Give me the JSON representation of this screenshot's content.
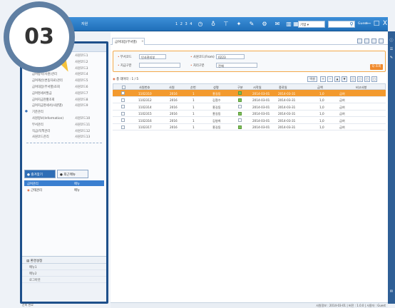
{
  "badge": {
    "number": "03"
  },
  "colors": {
    "accent": "#1f6fb9",
    "highlight": "#f39a2e",
    "sidebar_border": "#1d4f8a"
  },
  "topbar": {
    "app_title": "자원",
    "nums": "1 2 3 4",
    "tool_icons": [
      "clock-icon",
      "bulb-icon",
      "hanger-icon",
      "pin-icon",
      "edit-icon",
      "gear-icon",
      "mail-icon",
      "chart-icon",
      "calendar-icon"
    ],
    "menu_select": "기업 ▾",
    "user_name": "Guest",
    "window_buttons": [
      "—",
      "□",
      "X"
    ]
  },
  "sidebar": {
    "top_rows": [
      {
        "label": "",
        "value": "사원코드1"
      },
      {
        "label": "",
        "value": "사원코드2"
      },
      {
        "label": "",
        "value": "사원코드3"
      },
      {
        "label": "급여항목(사원)관리",
        "value": "사원코드4"
      },
      {
        "label": "급여계산(변동자료)관리",
        "value": "사원코드5"
      },
      {
        "label": "급여대장(부서별)조회",
        "value": "사원코드6"
      },
      {
        "label": "급여명세서발급",
        "value": "사원코드7"
      },
      {
        "label": "급여지급현황조회",
        "value": "사원코드8"
      },
      {
        "label": "급여지급명세서(사원별)",
        "value": "사원코드9"
      }
    ],
    "group_rows": [
      {
        "label": "기준관리",
        "value": ""
      },
      {
        "label": "사원정보(Information)",
        "value": "사원코드10"
      },
      {
        "label": "부서관리",
        "value": "사원코드11"
      },
      {
        "label": "직급/직책관리",
        "value": "사원코드12"
      },
      {
        "label": "사원코드관리",
        "value": "사원코드13"
      }
    ],
    "tabs": [
      {
        "label": "● 즐겨찾기"
      },
      {
        "label": "● 최근메뉴"
      }
    ],
    "selected_items": [
      {
        "label": "급여관리",
        "value": "메뉴"
      },
      {
        "label": "근태관리",
        "value": "메뉴"
      }
    ],
    "bottom_panel": {
      "title": "환경설정",
      "items": [
        "메뉴1",
        "메뉴2",
        "로그아웃"
      ]
    },
    "status_left": "준비 완료"
  },
  "main": {
    "doc_tab": "급여대장(부서별)",
    "doc_tab_close": "×",
    "filter": {
      "dept_label": "부서코드",
      "dept_value": "인사관리부",
      "emp_label": "사원코드(From)",
      "emp_value": "0223",
      "type_label": "지급구분",
      "type_value": "",
      "status_label": "처리구분",
      "status_value": "전체",
      "search_button": "Q 조회"
    },
    "summary": "총 데이터 : 1 / 5",
    "toolbar_buttons": [
      "엑셀",
      "+",
      "−",
      "▲",
      "▼",
      "□",
      "□",
      "□",
      "□"
    ],
    "columns": [
      "사원번호",
      "사원",
      "순번",
      "성명",
      "구분",
      "시작일",
      "종료일",
      "금액",
      "비고사항"
    ],
    "rows": [
      {
        "id": "1102310",
        "code": "2016",
        "seq": "1",
        "name": "홍길동",
        "checked": true,
        "start": "2014-03-01",
        "end": "2014-03-31",
        "amount": "1,0",
        "note": "급여",
        "selected": true
      },
      {
        "id": "1102312",
        "code": "2016",
        "seq": "1",
        "name": "김철수",
        "checked": true,
        "start": "2014-03-01",
        "end": "2014-03-31",
        "amount": "1,0",
        "note": "급여",
        "selected": false
      },
      {
        "id": "1102314",
        "code": "2016",
        "seq": "1",
        "name": "홍길동",
        "checked": false,
        "start": "2014-03-01",
        "end": "2014-03-31",
        "amount": "1,0",
        "note": "급여",
        "selected": false
      },
      {
        "id": "1102315",
        "code": "2016",
        "seq": "1",
        "name": "홍길동",
        "checked": true,
        "start": "2014-03-01",
        "end": "2014-03-31",
        "amount": "1,0",
        "note": "급여",
        "selected": false
      },
      {
        "id": "1102316",
        "code": "2016",
        "seq": "1",
        "name": "김영희",
        "checked": false,
        "start": "2014-03-01",
        "end": "2014-03-31",
        "amount": "1,0",
        "note": "급여",
        "selected": false
      },
      {
        "id": "1102317",
        "code": "2016",
        "seq": "1",
        "name": "홍길동",
        "checked": true,
        "start": "2014-03-01",
        "end": "2014-03-31",
        "amount": "1,0",
        "note": "급여",
        "selected": false
      }
    ],
    "status_right": "사원정보 : 2014-03-01 | 버전 : 1.0.0 | 사용자 : Guest"
  },
  "rightstrip": {
    "icons": [
      "info-icon",
      "list-icon",
      "edit-icon",
      "chat-icon"
    ]
  }
}
